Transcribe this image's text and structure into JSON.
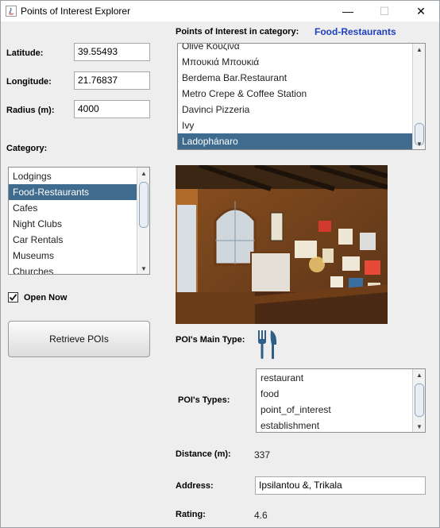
{
  "window": {
    "title": "Points of Interest Explorer",
    "min_symbol": "—",
    "max_symbol": "☐",
    "close_symbol": "✕"
  },
  "form": {
    "latitude_label": "Latitude:",
    "latitude_value": "39.55493",
    "longitude_label": "Longitude:",
    "longitude_value": "21.76837",
    "radius_label": "Radius (m):",
    "radius_value": "4000",
    "category_label": "Category:",
    "open_now_label": "Open Now",
    "open_now_checked": true,
    "retrieve_button": "Retrieve POIs"
  },
  "categories": {
    "items": [
      "Lodgings",
      "Food-Restaurants",
      "Cafes",
      "Night Clubs",
      "Car Rentals",
      "Museums",
      "Churches"
    ],
    "selected": "Food-Restaurants"
  },
  "poi_panel": {
    "header_label": "Points of Interest in category:",
    "category_name": "Food-Restaurants",
    "items": [
      "Olive Κουζίνα",
      "Μπουκιά Μπουκιά",
      "Berdema Bar.Restaurant",
      "Metro Crepe & Coffee Station",
      "Davinci Pizzeria",
      "Ivy",
      "Ladophánaro"
    ],
    "selected": "Ladophánaro"
  },
  "details": {
    "main_type_label": "POI's Main Type:",
    "main_type_icon": "fork-knife-icon",
    "types_label": "POI's Types:",
    "types": [
      "restaurant",
      "food",
      "point_of_interest",
      "establishment"
    ],
    "distance_label": "Distance (m):",
    "distance_value": "337",
    "address_label": "Address:",
    "address_value": "Ipsilantou &, Trikala",
    "rating_label": "Rating:",
    "rating_value": "4.6"
  },
  "colors": {
    "selection": "#3f6b8e",
    "category_name": "#1f3fbf",
    "icon": "#2f5f88"
  }
}
